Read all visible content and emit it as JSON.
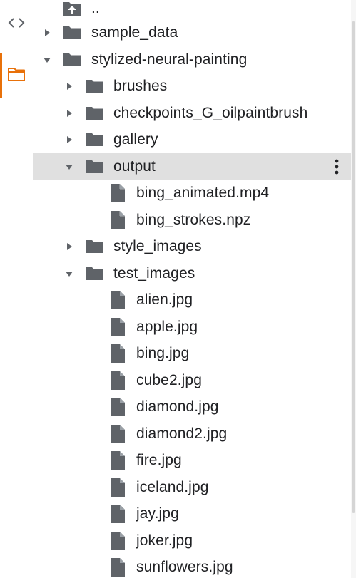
{
  "rail": {
    "code_icon": "code-icon",
    "files_icon": "folder-outline-icon",
    "accent_color": "#e8710a"
  },
  "tree": {
    "parent_label": "..",
    "items": [
      {
        "label": "sample_data",
        "type": "folder",
        "state": "collapsed"
      },
      {
        "label": "stylized-neural-painting",
        "type": "folder",
        "state": "expanded"
      },
      {
        "label": "brushes",
        "type": "folder",
        "state": "collapsed"
      },
      {
        "label": "checkpoints_G_oilpaintbrush",
        "type": "folder",
        "state": "collapsed"
      },
      {
        "label": "gallery",
        "type": "folder",
        "state": "collapsed"
      },
      {
        "label": "output",
        "type": "folder",
        "state": "expanded"
      },
      {
        "label": "bing_animated.mp4",
        "type": "file"
      },
      {
        "label": "bing_strokes.npz",
        "type": "file"
      },
      {
        "label": "style_images",
        "type": "folder",
        "state": "collapsed"
      },
      {
        "label": "test_images",
        "type": "folder",
        "state": "expanded"
      },
      {
        "label": "alien.jpg",
        "type": "file"
      },
      {
        "label": "apple.jpg",
        "type": "file"
      },
      {
        "label": "bing.jpg",
        "type": "file"
      },
      {
        "label": "cube2.jpg",
        "type": "file"
      },
      {
        "label": "diamond.jpg",
        "type": "file"
      },
      {
        "label": "diamond2.jpg",
        "type": "file"
      },
      {
        "label": "fire.jpg",
        "type": "file"
      },
      {
        "label": "iceland.jpg",
        "type": "file"
      },
      {
        "label": "jay.jpg",
        "type": "file"
      },
      {
        "label": "joker.jpg",
        "type": "file"
      },
      {
        "label": "sunflowers.jpg",
        "type": "file"
      }
    ]
  },
  "colors": {
    "icon_gray": "#5f6368",
    "selected_row": "#e0e0e0",
    "text": "#202124"
  }
}
